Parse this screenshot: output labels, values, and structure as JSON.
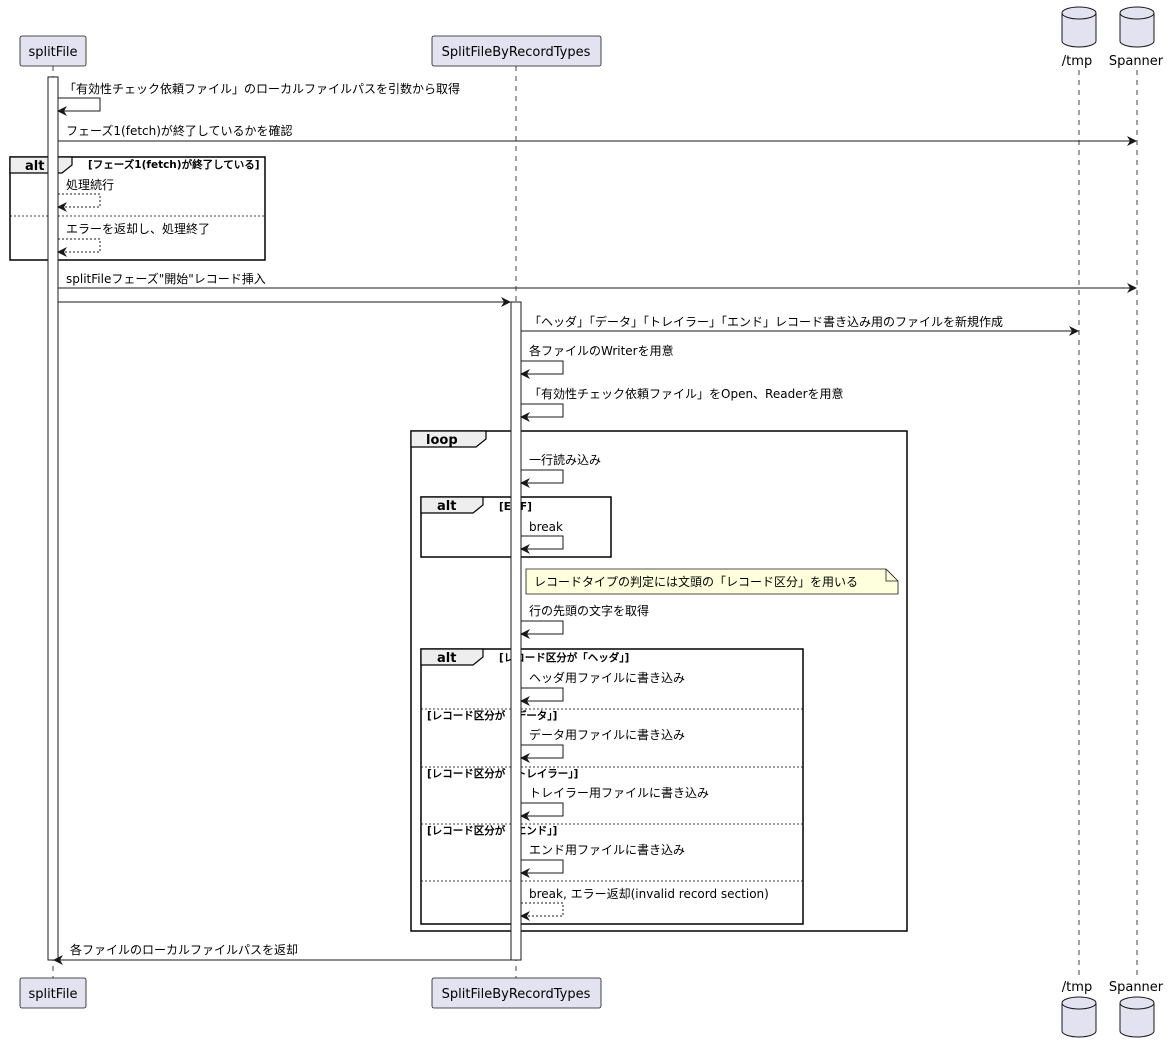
{
  "participants": {
    "splitfile": "splitFile",
    "splitbytypes": "SplitFileByRecordTypes",
    "tmp": "/tmp",
    "spanner": "Spanner"
  },
  "messages": {
    "m1": "「有効性チェック依頼ファイル」のローカルファイルパスを引数から取得",
    "m2": "フェーズ1(fetch)が終了しているかを確認",
    "m3": "処理続行",
    "m4": "エラーを返却し、処理終了",
    "m5": "splitFileフェーズ\"開始\"レコード挿入",
    "m6": "「ヘッダ」「データ」「トレイラー」「エンド」レコード書き込み用のファイルを新規作成",
    "m7": "各ファイルのWriterを用意",
    "m8": "「有効性チェック依頼ファイル」をOpen、Readerを用意",
    "m9": "一行読み込み",
    "m10": "break",
    "m11": "行の先頭の文字を取得",
    "m12": "ヘッダ用ファイルに書き込み",
    "m13": "データ用ファイルに書き込み",
    "m14": "トレイラー用ファイルに書き込み",
    "m15": "エンド用ファイルに書き込み",
    "m16": "break, エラー返却(invalid record section)",
    "m17": "各ファイルのローカルファイルパスを返却"
  },
  "groups": {
    "alt1": {
      "label": "alt",
      "cond": "[フェーズ1(fetch)が終了している]"
    },
    "loop1": {
      "label": "loop"
    },
    "alt2": {
      "label": "alt",
      "cond": "[EOF]"
    },
    "alt3": {
      "label": "alt",
      "cond": "[レコード区分が「ヘッダ」]",
      "else1": "[レコード区分が「データ」]",
      "else2": "[レコード区分が「トレイラー」]",
      "else3": "[レコード区分が「エンド」]"
    }
  },
  "note": "レコードタイプの判定には文頭の「レコード区分」を用いる",
  "colors": {
    "participant_fill": "#E2E2F0",
    "participant_border": "#181818",
    "note_fill": "#FEFFDD",
    "lifeline": "#181818",
    "activation_fill": "#FFFFFF"
  },
  "icons": {
    "tmp": "database-icon",
    "spanner": "database-icon"
  }
}
